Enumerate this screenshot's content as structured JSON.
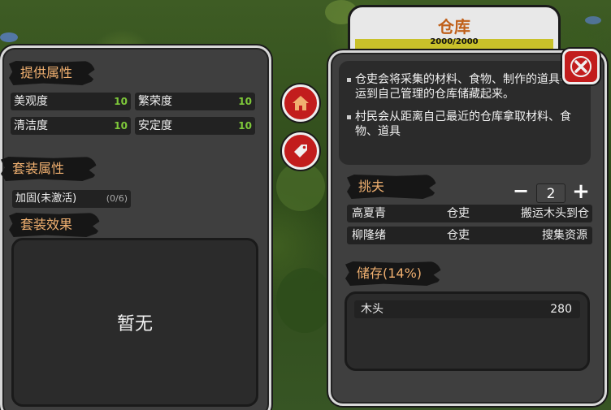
{
  "left_panel": {
    "provide_attrs": {
      "header": "提供属性",
      "items": [
        {
          "label": "美观度",
          "value": "10"
        },
        {
          "label": "繁荣度",
          "value": "10"
        },
        {
          "label": "清洁度",
          "value": "10"
        },
        {
          "label": "安定度",
          "value": "10"
        }
      ]
    },
    "set_attrs": {
      "header": "套装属性",
      "item_label": "加固(未激活)",
      "item_count": "(0/6)"
    },
    "set_effect": {
      "header": "套装效果",
      "empty_text": "暂无"
    }
  },
  "side_buttons": {
    "home_icon": "home-icon",
    "tag_icon": "tag-icon"
  },
  "right_panel": {
    "title": "仓库",
    "capacity_text": "2000/2000",
    "capacity_fraction": 1.0,
    "close_icon": "close-icon",
    "description": [
      "仓吏会将采集的材料、食物、制作的道具等搬运到自己管理的仓库储藏起来。",
      "村民会从距离自己最近的仓库拿取材料、食物、道具"
    ],
    "porters": {
      "header": "挑夫",
      "minus_label": "−",
      "plus_label": "+",
      "count": "2",
      "rows": [
        {
          "name": "高夏青",
          "role": "仓吏",
          "task": "搬运木头到仓"
        },
        {
          "name": "柳隆绪",
          "role": "仓吏",
          "task": "搜集资源"
        }
      ]
    },
    "storage": {
      "header": "储存(14%)",
      "items": [
        {
          "name": "木头",
          "amount": "280"
        }
      ]
    }
  },
  "colors": {
    "accent_orange": "#f0b070",
    "value_green": "#7ec83a",
    "button_red": "#c21d1d",
    "bar_yellow": "#c9c12a"
  }
}
